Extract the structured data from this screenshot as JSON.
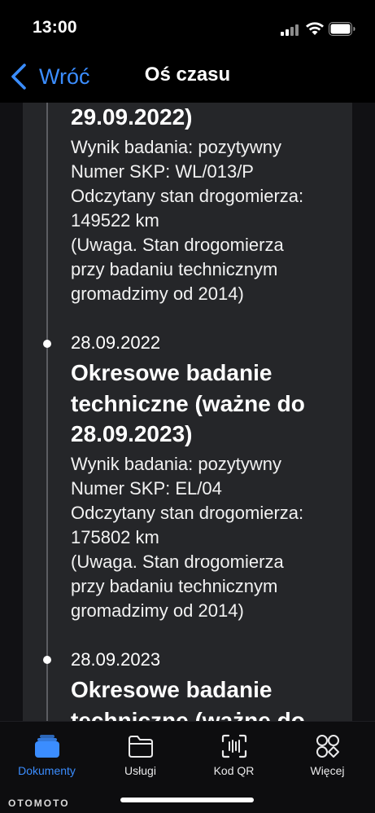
{
  "status_bar": {
    "time": "13:00"
  },
  "nav": {
    "back_label": "Wróć",
    "title": "Oś czasu"
  },
  "timeline": {
    "partial_entry": {
      "title_tail": "29.09.2022)",
      "lines": [
        "Wynik badania: pozytywny",
        "Numer SKP: WL/013/P",
        "Odczytany stan drogomierza:",
        "149522 km",
        "(Uwaga. Stan drogomierza",
        "przy badaniu technicznym",
        "gromadzimy od 2014)"
      ]
    },
    "entry_2": {
      "date": "28.09.2022",
      "title_lines": [
        "Okresowe badanie",
        "techniczne (ważne do",
        "28.09.2023)"
      ],
      "lines": [
        "Wynik badania: pozytywny",
        "Numer SKP: EL/04",
        "Odczytany stan drogomierza:",
        "175802 km",
        "(Uwaga. Stan drogomierza",
        "przy badaniu technicznym",
        "gromadzimy od 2014)"
      ]
    },
    "entry_3": {
      "date": "28.09.2023",
      "title_lines": [
        "Okresowe badanie",
        "techniczne (ważne do"
      ]
    }
  },
  "tabs": [
    {
      "label": "Dokumenty",
      "icon": "documents-stack-icon",
      "active": true
    },
    {
      "label": "Usługi",
      "icon": "folder-icon",
      "active": false
    },
    {
      "label": "Kod QR",
      "icon": "qr-scan-icon",
      "active": false
    },
    {
      "label": "Więcej",
      "icon": "more-grid-icon",
      "active": false
    }
  ],
  "watermark": "OTOMOTO",
  "colors": {
    "accent": "#3b8dff",
    "card": "#252629",
    "background": "#111114"
  }
}
